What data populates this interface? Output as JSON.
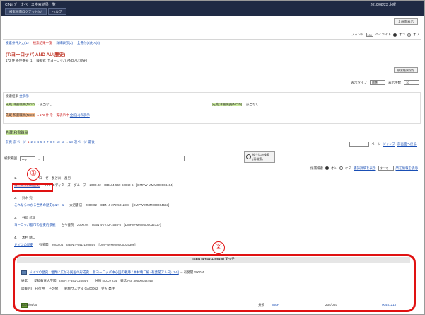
{
  "header": {
    "app_title": "CiNii データベース検索結果一覧",
    "date": "2010/08/23 木曜",
    "tabs": [
      "検索画面ログアウト(O)",
      "ヘルプ"
    ],
    "top_button": "全画面表示",
    "font_label": "フォント",
    "font_value": "100",
    "highlight_label": "ハイライト",
    "on": "オン",
    "off": "オフ"
  },
  "breadcrumbs": [
    "検索条件入力(1)",
    "検索結果一覧",
    "詳細表示(2)",
    "全冊付(3)もA(5)"
  ],
  "query": {
    "title": "(T:ヨーロッパ AND AU:歴史)",
    "count": "172 件",
    "info": "条件番号 [1]　検索式 (T:ヨーロッパ AND AU:歴史)",
    "save_button": "検索結果保存"
  },
  "display": {
    "type_label": "表示タイプ",
    "type_value": "標準",
    "count_label": "表示件数",
    "count_value": "10"
  },
  "result_panel": {
    "heading": "検索結果",
    "heading_link": "全表示",
    "rows": [
      {
        "label": "先蔵 洋書職員(NCID)",
        "text": "→該当なし"
      },
      {
        "label": "先蔵 洋書職員(NCID)",
        "text": "→該当なし"
      },
      {
        "label": "先蔵 和書職員(NCID)",
        "text": "→172 件 を一覧表示中",
        "link": "全館(4)の表示"
      }
    ]
  },
  "section_label": "先蔵 和書職員",
  "pager": {
    "prev": "前頁",
    "prev_page": "前ページ",
    "pages": [
      "1",
      "2",
      "3",
      "4",
      "5",
      "6",
      "7",
      "8",
      "9",
      "10",
      "11",
      "..",
      "18"
    ],
    "next_page": "次ページ",
    "last": "最後",
    "jump_label": "ページ",
    "jump_button": "ジャンプ",
    "back_link": "前画面へ戻る"
  },
  "filter": {
    "label": "検索範囲",
    "select_value": "Any",
    "narrow_button": "絞り込み検索\n(再検索)",
    "sort_label": "候補検索",
    "on": "オン",
    "off": "オフ",
    "sort_link": "書誌詳細を表示",
    "all_value": "すべて",
    "holder_link": "所在情報を表示"
  },
  "records": [
    {
      "num": "1.",
      "author": "ローゼ　長谷川　昌男",
      "title": "ヨーロッパの歴史",
      "detail": "PHPエディターズ・グループ　2000.02　ISBN 4-569-60840-6　[DMPW-MMM000064464]"
    },
    {
      "num": "2.",
      "author": "鈴木 亮",
      "title": "これならわかる世界の歴史Q&A　1",
      "detail": "大月書店　2000.02　ISBN 4-272-50123-8　[DMPW-MMM000064563]"
    },
    {
      "num": "3.",
      "author": "谷岡 武雄",
      "title": "ヨーロッパ都市の歴史的景観",
      "detail": "古今書院　2000.04　ISBN 4-7722-1535-5　[DMPW-MMM000032127]"
    },
    {
      "num": "4.",
      "author": "木村 靖二",
      "title": "ドイツの歴史",
      "detail": "有斐閣　2000.04　ISBN 4-641-12084-5　[DMPW-MMM000035306]"
    }
  ],
  "annotations": {
    "a1": "①",
    "a2": "②"
  },
  "detail_block": {
    "heading": "ISBN (4-641-12084-5) マッチ",
    "title_line": "ドイツの歴史 : 世界に広がる民国の形成史... 新ヨーロッパ中心国の軌跡 / 木村靖二編 (有斐閣アルマ) [1-5]",
    "title_tail": "--- 有斐閣 2000.4",
    "line2": "通常　　愛知教育大学図　ISBN 4-641-12084-5　　分類 NDC9 234　書誌 No. 3050004244S",
    "line3": "図書 N)　刊行 中　その他　　総統ウスヤN: GA00062　受入 発注",
    "footer_date": "2001/04/05",
    "footer_cls": "分類",
    "footer_map": "MAP",
    "footer_num": "234/D93",
    "footer_code": "00451213"
  }
}
